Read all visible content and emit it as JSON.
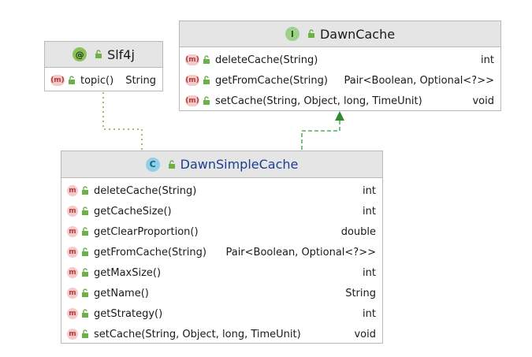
{
  "slf4j": {
    "badge": "@",
    "name": "Slf4j",
    "members": [
      {
        "badge": "(m)",
        "signature": "topic()",
        "type": "String"
      }
    ]
  },
  "dawn_cache": {
    "badge": "I",
    "name": "DawnCache",
    "members": [
      {
        "badge": "(m)",
        "signature": "deleteCache(String)",
        "type": "int"
      },
      {
        "badge": "(m)",
        "signature": "getFromCache(String)",
        "type": "Pair<Boolean, Optional<?>>"
      },
      {
        "badge": "(m)",
        "signature": "setCache(String, Object, long, TimeUnit)",
        "type": "void"
      }
    ]
  },
  "dawn_simple_cache": {
    "badge": "C",
    "name": "DawnSimpleCache",
    "members": [
      {
        "badge": "m",
        "signature": "deleteCache(String)",
        "type": "int"
      },
      {
        "badge": "m",
        "signature": "getCacheSize()",
        "type": "int"
      },
      {
        "badge": "m",
        "signature": "getClearProportion()",
        "type": "double"
      },
      {
        "badge": "m",
        "signature": "getFromCache(String)",
        "type": "Pair<Boolean, Optional<?>>"
      },
      {
        "badge": "m",
        "signature": "getMaxSize()",
        "type": "int"
      },
      {
        "badge": "m",
        "signature": "getName()",
        "type": "String"
      },
      {
        "badge": "m",
        "signature": "getStrategy()",
        "type": "int"
      },
      {
        "badge": "m",
        "signature": "setCache(String, Object, long, TimeUnit)",
        "type": "void"
      }
    ]
  },
  "colors": {
    "header_bg": "#e5e5e5",
    "border": "#b9b9b9",
    "class_name": "#1b3f8f",
    "method_badge": "#f4c9c9",
    "lock": "#6cb04a",
    "annotation_edge": "#9fc25a",
    "implements_edge": "#3a9a3a"
  },
  "icons": {
    "annotation": "annotation-icon",
    "interface": "interface-icon",
    "class": "class-icon",
    "method": "method-icon",
    "visibility": "public-lock-icon"
  }
}
